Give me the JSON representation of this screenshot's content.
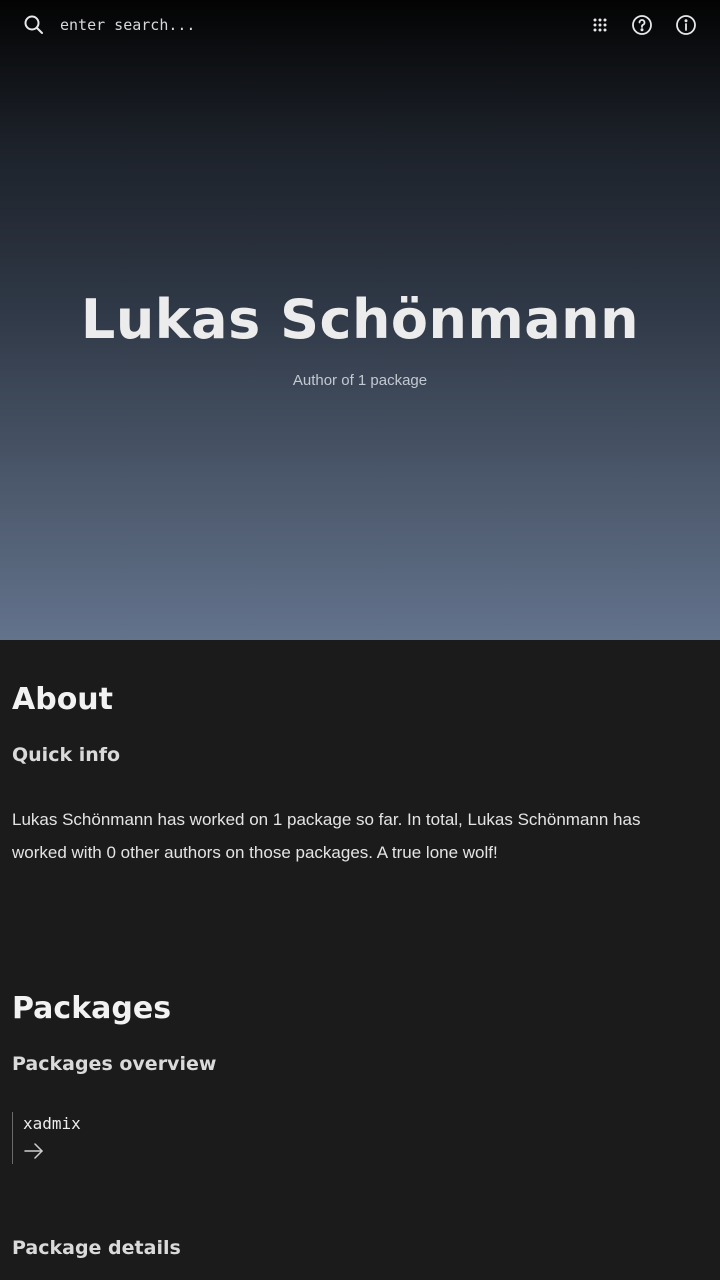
{
  "search": {
    "placeholder": "enter search...",
    "icon": "search-icon"
  },
  "toolbar": {
    "icons": [
      "grid-icon",
      "help-icon",
      "info-icon"
    ]
  },
  "hero": {
    "title": "Lukas Schönmann",
    "subtitle": "Author of 1 package"
  },
  "about": {
    "heading": "About",
    "subheading": "Quick info",
    "paragraph": "Lukas Schönmann has worked on 1 package so far. In total, Lukas Schönmann has worked with 0 other authors on those packages. A true lone wolf!"
  },
  "packages": {
    "heading": "Packages",
    "overview_heading": "Packages overview",
    "items": [
      {
        "name": "xadmix",
        "icon": "arrow-right-icon"
      }
    ],
    "details_heading": "Package details"
  },
  "colors": {
    "background": "#1b1b1c",
    "hero_top": "#030303",
    "hero_bottom": "#63738c",
    "text": "#ececec"
  }
}
